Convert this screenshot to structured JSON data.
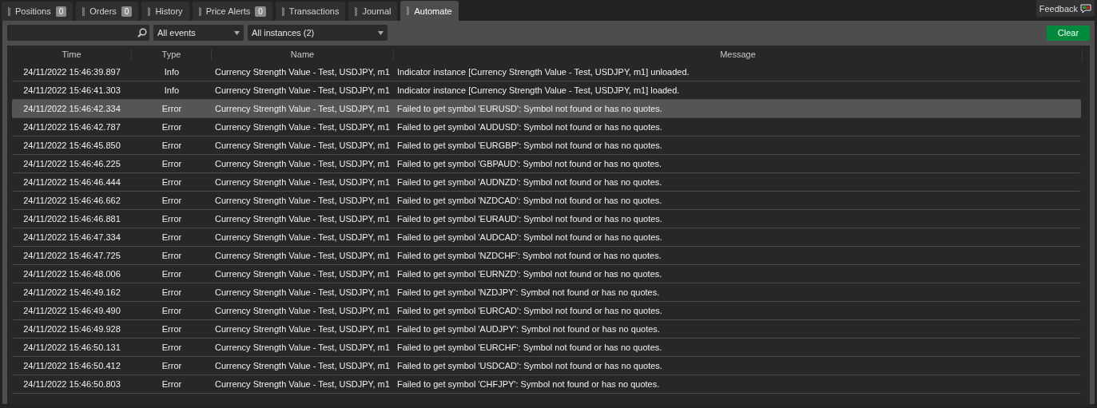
{
  "tabs": [
    {
      "label": "Positions",
      "badge": "0",
      "selected": false
    },
    {
      "label": "Orders",
      "badge": "0",
      "selected": false
    },
    {
      "label": "History",
      "selected": false
    },
    {
      "label": "Price Alerts",
      "badge": "0",
      "selected": false
    },
    {
      "label": "Transactions",
      "selected": false
    },
    {
      "label": "Journal",
      "selected": false
    },
    {
      "label": "Automate",
      "selected": true
    }
  ],
  "feedback": {
    "label": "Feedback"
  },
  "toolbar": {
    "event_filter": "All events",
    "instance_filter": "All instances (2)",
    "clear_button": "Clear"
  },
  "table": {
    "columns": [
      "Time",
      "Type",
      "Name",
      "Message"
    ],
    "rows": [
      {
        "time": "24/11/2022 15:46:39.897",
        "type": "Info",
        "name": "Currency Strength Value - Test, USDJPY, m1",
        "message": "Indicator instance [Currency Strength Value - Test, USDJPY, m1] unloaded.",
        "selected": false
      },
      {
        "time": "24/11/2022 15:46:41.303",
        "type": "Info",
        "name": "Currency Strength Value - Test, USDJPY, m1",
        "message": "Indicator instance [Currency Strength Value - Test, USDJPY, m1] loaded.",
        "selected": false
      },
      {
        "time": "24/11/2022 15:46:42.334",
        "type": "Error",
        "name": "Currency Strength Value - Test, USDJPY, m1",
        "message": "Failed to get symbol 'EURUSD': Symbol not found or has no quotes.",
        "selected": true
      },
      {
        "time": "24/11/2022 15:46:42.787",
        "type": "Error",
        "name": "Currency Strength Value - Test, USDJPY, m1",
        "message": "Failed to get symbol 'AUDUSD': Symbol not found or has no quotes.",
        "selected": false
      },
      {
        "time": "24/11/2022 15:46:45.850",
        "type": "Error",
        "name": "Currency Strength Value - Test, USDJPY, m1",
        "message": "Failed to get symbol 'EURGBP': Symbol not found or has no quotes.",
        "selected": false
      },
      {
        "time": "24/11/2022 15:46:46.225",
        "type": "Error",
        "name": "Currency Strength Value - Test, USDJPY, m1",
        "message": "Failed to get symbol 'GBPAUD': Symbol not found or has no quotes.",
        "selected": false
      },
      {
        "time": "24/11/2022 15:46:46.444",
        "type": "Error",
        "name": "Currency Strength Value - Test, USDJPY, m1",
        "message": "Failed to get symbol 'AUDNZD': Symbol not found or has no quotes.",
        "selected": false
      },
      {
        "time": "24/11/2022 15:46:46.662",
        "type": "Error",
        "name": "Currency Strength Value - Test, USDJPY, m1",
        "message": "Failed to get symbol 'NZDCAD': Symbol not found or has no quotes.",
        "selected": false
      },
      {
        "time": "24/11/2022 15:46:46.881",
        "type": "Error",
        "name": "Currency Strength Value - Test, USDJPY, m1",
        "message": "Failed to get symbol 'EURAUD': Symbol not found or has no quotes.",
        "selected": false
      },
      {
        "time": "24/11/2022 15:46:47.334",
        "type": "Error",
        "name": "Currency Strength Value - Test, USDJPY, m1",
        "message": "Failed to get symbol 'AUDCAD': Symbol not found or has no quotes.",
        "selected": false
      },
      {
        "time": "24/11/2022 15:46:47.725",
        "type": "Error",
        "name": "Currency Strength Value - Test, USDJPY, m1",
        "message": "Failed to get symbol 'NZDCHF': Symbol not found or has no quotes.",
        "selected": false
      },
      {
        "time": "24/11/2022 15:46:48.006",
        "type": "Error",
        "name": "Currency Strength Value - Test, USDJPY, m1",
        "message": "Failed to get symbol 'EURNZD': Symbol not found or has no quotes.",
        "selected": false
      },
      {
        "time": "24/11/2022 15:46:49.162",
        "type": "Error",
        "name": "Currency Strength Value - Test, USDJPY, m1",
        "message": "Failed to get symbol 'NZDJPY': Symbol not found or has no quotes.",
        "selected": false
      },
      {
        "time": "24/11/2022 15:46:49.490",
        "type": "Error",
        "name": "Currency Strength Value - Test, USDJPY, m1",
        "message": "Failed to get symbol 'EURCAD': Symbol not found or has no quotes.",
        "selected": false
      },
      {
        "time": "24/11/2022 15:46:49.928",
        "type": "Error",
        "name": "Currency Strength Value - Test, USDJPY, m1",
        "message": "Failed to get symbol 'AUDJPY': Symbol not found or has no quotes.",
        "selected": false
      },
      {
        "time": "24/11/2022 15:46:50.131",
        "type": "Error",
        "name": "Currency Strength Value - Test, USDJPY, m1",
        "message": "Failed to get symbol 'EURCHF': Symbol not found or has no quotes.",
        "selected": false
      },
      {
        "time": "24/11/2022 15:46:50.412",
        "type": "Error",
        "name": "Currency Strength Value - Test, USDJPY, m1",
        "message": "Failed to get symbol 'USDCAD': Symbol not found or has no quotes.",
        "selected": false
      },
      {
        "time": "24/11/2022 15:46:50.803",
        "type": "Error",
        "name": "Currency Strength Value - Test, USDJPY, m1",
        "message": "Failed to get symbol 'CHFJPY': Symbol not found or has no quotes.",
        "selected": false
      }
    ]
  }
}
